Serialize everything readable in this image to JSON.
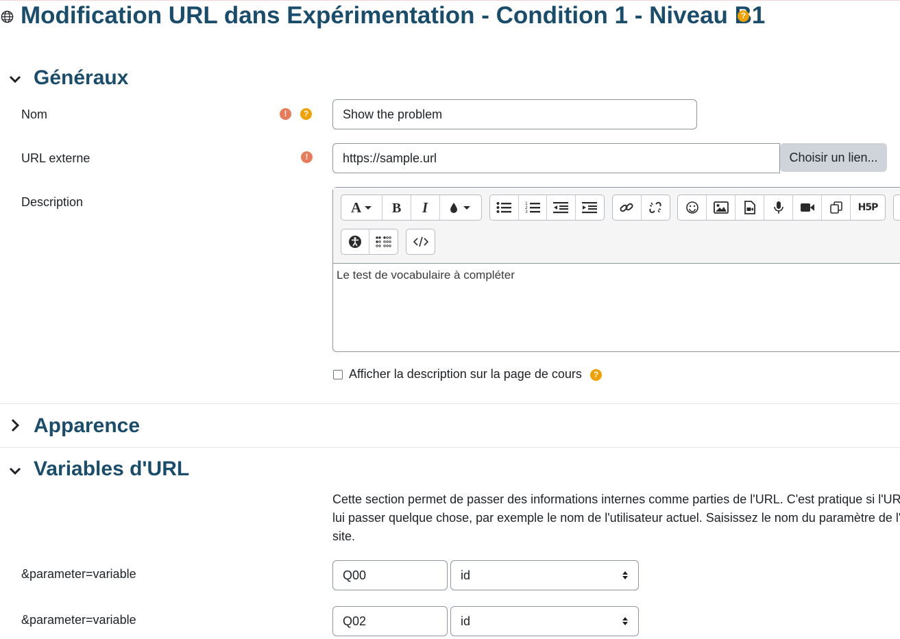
{
  "page": {
    "title": "Modification URL dans Expérimentation - Condition 1 - Niveau B1",
    "title_icon": "globe-icon",
    "help_icon": "question-circle-icon",
    "required_icon": "exclamation-circle-icon"
  },
  "sections": {
    "generaux": {
      "title": "Généraux",
      "expanded": true
    },
    "apparence": {
      "title": "Apparence",
      "expanded": false
    },
    "variables": {
      "title": "Variables d'URL",
      "expanded": true
    }
  },
  "form": {
    "nom": {
      "label": "Nom",
      "value": "Show the problem"
    },
    "url": {
      "label": "URL externe",
      "value": "https://sample.url",
      "button": "Choisir un lien..."
    },
    "description": {
      "label": "Description",
      "content": "Le test de vocabulaire à compléter",
      "toolbar_icons": [
        "font-icon",
        "bold-icon",
        "italic-icon",
        "text-color-icon",
        "bullet-list-icon",
        "numbered-list-icon",
        "outdent-icon",
        "indent-icon",
        "link-icon",
        "unlink-icon",
        "emoji-icon",
        "image-icon",
        "media-icon",
        "microphone-icon",
        "video-icon",
        "copy-icon",
        "h5p-icon",
        "accessibility-icon",
        "braille-icon",
        "html-source-icon"
      ],
      "h5p_text": "H5P"
    },
    "show_description": {
      "label": "Afficher la description sur la page de cours",
      "checked": false
    }
  },
  "variables": {
    "intro": [
      "Cette section permet de passer des informations internes comme parties de l'URL. C'est pratique si l'URL",
      "lui passer quelque chose, par exemple le nom de l'utilisateur actuel. Saisissez le nom du paramètre de l'U",
      "site."
    ],
    "rows": [
      {
        "label": "&parameter=variable",
        "param": "Q00",
        "variable": "id"
      },
      {
        "label": "&parameter=variable",
        "param": "Q02",
        "variable": "id"
      }
    ]
  },
  "colors": {
    "heading": "#1a4c6b",
    "help": "#f0a100",
    "required": "#e87c5a",
    "button_secondary": "#ced4da"
  }
}
